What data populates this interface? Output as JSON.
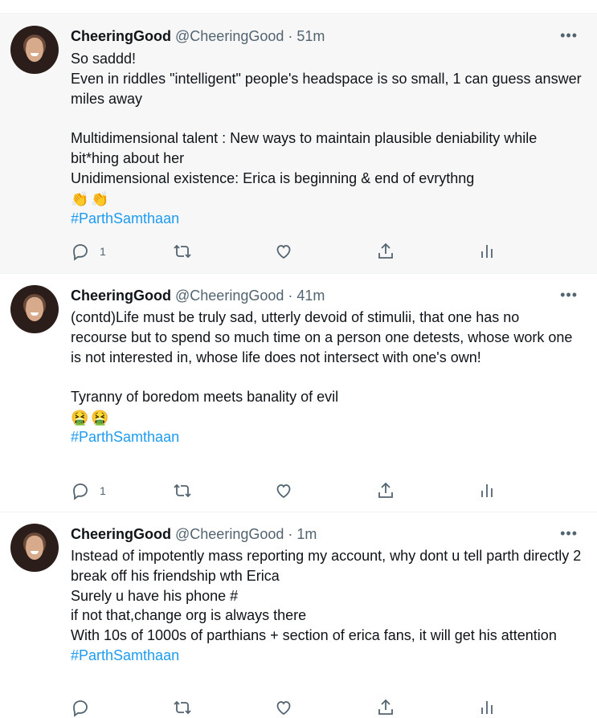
{
  "tweets": [
    {
      "name": "CheeringGood",
      "handle": "@CheeringGood",
      "sep": "·",
      "time": "51m",
      "more": "•••",
      "lines": [
        "So saddd!",
        "Even in riddles \"intelligent\" people's headspace is so small, 1 can guess answer miles away",
        "",
        "Multidimensional talent : New ways to maintain plausible deniability while bit*hing about her",
        "Unidimensional existence: Erica is beginning & end of evrythng"
      ],
      "emojis": [
        "👏",
        "👏"
      ],
      "hashtag": "#ParthSamthaan",
      "reply_count": "1"
    },
    {
      "name": "CheeringGood",
      "handle": "@CheeringGood",
      "sep": "·",
      "time": "41m",
      "more": "•••",
      "lines": [
        "(contd)Life must be truly sad, utterly devoid of stimulii, that one has no recourse but to spend so much time on a person one detests, whose work one is not interested in, whose life does not intersect with one's own!",
        "",
        "Tyranny of boredom meets banality of evil"
      ],
      "emojis": [
        "🤮",
        "🤮"
      ],
      "hashtag": "#ParthSamthaan",
      "reply_count": "1"
    },
    {
      "name": "CheeringGood",
      "handle": "@CheeringGood",
      "sep": "·",
      "time": "1m",
      "more": "•••",
      "lines": [
        "Instead of impotently mass reporting my account, why dont u tell parth directly 2 break off his friendship wth Erica",
        "Surely u have his phone #",
        "if not that,change org is always there",
        "With 10s of 1000s of parthians + section of erica fans, it will get his attention"
      ],
      "hashtag": "#ParthSamthaan"
    }
  ],
  "icons": {
    "reply": "reply-icon",
    "retweet": "retweet-icon",
    "like": "heart-icon",
    "share": "share-icon",
    "analytics": "analytics-icon",
    "more": "more-icon"
  },
  "colors": {
    "hashtag": "#1d9bf0",
    "muted": "#536471",
    "thread_line": "#cfd9de",
    "highlight_bg": "#f7f7f7"
  }
}
